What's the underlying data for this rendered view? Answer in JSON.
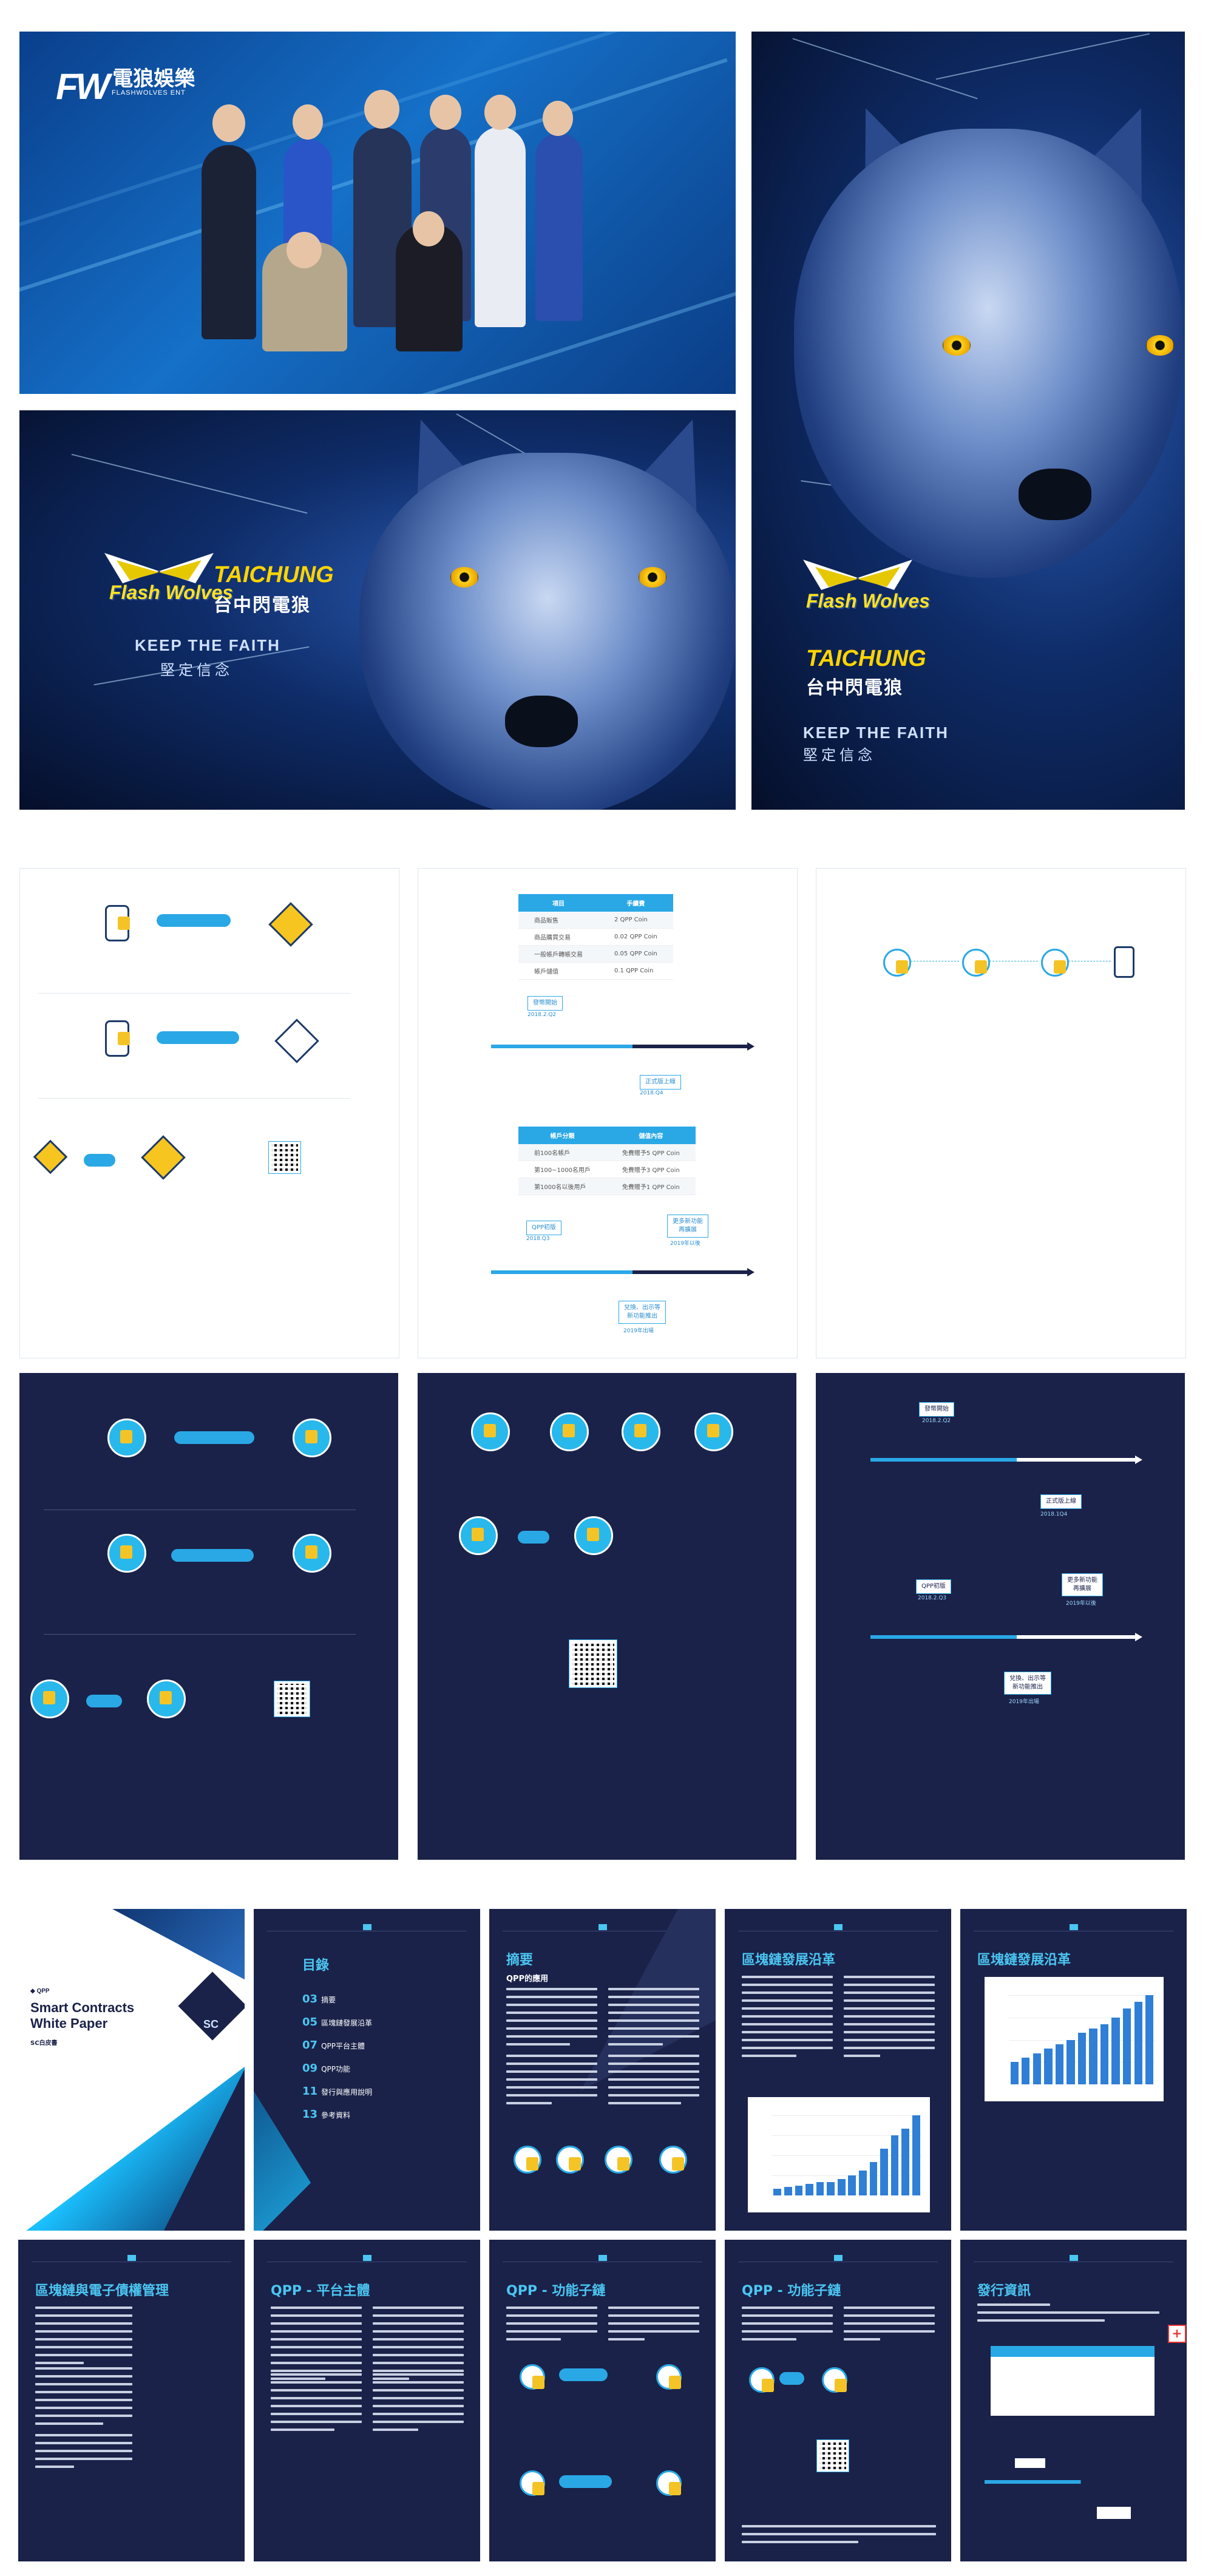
{
  "team_photo": {
    "brand_cn": "電狼娛樂",
    "brand_en": "FLASHWOLVES ENT"
  },
  "wolf_wide": {
    "team_name": "Flash Wolves",
    "city": "TAICHUNG",
    "team_cn": "台中閃電狼",
    "slogan": "KEEP THE FAITH",
    "slogan_cn": "堅定信念"
  },
  "wolf_tall": {
    "team_name": "Flash Wolves",
    "city": "TAICHUNG",
    "team_cn": "台中閃電狼",
    "slogan": "KEEP THE FAITH",
    "slogan_cn": "堅定信念"
  },
  "white_fee_page": {
    "table1": {
      "headers": [
        "項目",
        "手續費"
      ],
      "rows": [
        [
          "商品販售",
          "2 QPP Coin"
        ],
        [
          "商品購買交易",
          "0.02 QPP Coin"
        ],
        [
          "一般帳戶轉帳交易",
          "0.05 QPP Coin"
        ],
        [
          "帳戶儲值",
          "0.1 QPP Coin"
        ]
      ]
    },
    "table2": {
      "headers": [
        "帳戶分類",
        "儲值內容"
      ],
      "rows": [
        [
          "前100名帳戶",
          "免費贈予5 QPP Coin"
        ],
        [
          "第100~1000名用戶",
          "免費贈予3 QPP Coin"
        ],
        [
          "第1000名以後用戶",
          "免費贈予1 QPP Coin"
        ]
      ]
    },
    "tags": [
      "發幣開始",
      "正式版上線",
      "QPP初版",
      "更多新功能\n再擴展",
      "兌換、出示等\n新功能推出"
    ],
    "dates": [
      "2018.2.Q2",
      "2018.Q4",
      "2018.Q3",
      "2019年以後",
      "2019年出場"
    ]
  },
  "dark_timeline": {
    "tags": [
      "發幣開始",
      "正式版上線",
      "QPP初版",
      "更多新功能\n再擴展",
      "兌換、出示等\n新功能推出"
    ],
    "dates": [
      "2018.2.Q2",
      "2018.1Q4",
      "2018.2.Q3",
      "2019年以後",
      "2019年出場"
    ]
  },
  "white_paper": {
    "cover_title": "Smart Contracts\nWhite Paper",
    "cover_sub": "SC白皮書",
    "cover_logo": "SC",
    "toc_title": "目錄",
    "toc": [
      [
        "03",
        "摘要"
      ],
      [
        "05",
        "區塊鏈發展沿革"
      ],
      [
        "07",
        "QPP平台主體"
      ],
      [
        "09",
        "QPP功能"
      ],
      [
        "11",
        "發行與應用說明"
      ],
      [
        "13",
        "參考資料"
      ]
    ],
    "summary_title": "摘要",
    "summary_sub": "QPP的應用",
    "history_title": "區塊鏈發展沿革",
    "history2_title": "區塊鏈發展沿革",
    "ecommerce_title": "區塊鏈與電子債權管理",
    "platform_title": "QPP - 平台主體",
    "features_title": "QPP - 功能子鏈",
    "features2_title": "QPP - 功能子鏈",
    "issue_title": "發行資訊"
  },
  "chart_data": [
    {
      "type": "bar",
      "title": "",
      "values": [
        4,
        5,
        6,
        7,
        8,
        8,
        10,
        12,
        15,
        20,
        28,
        36,
        40,
        48
      ]
    },
    {
      "type": "bar",
      "title": "",
      "values": [
        20,
        24,
        28,
        32,
        36,
        40,
        46,
        50,
        54,
        60,
        68,
        74,
        80
      ]
    }
  ],
  "colors": {
    "navy": "#1a2249",
    "cyan": "#2aa8e6",
    "accent": "#4bc6f2",
    "gold": "#ffd400"
  }
}
